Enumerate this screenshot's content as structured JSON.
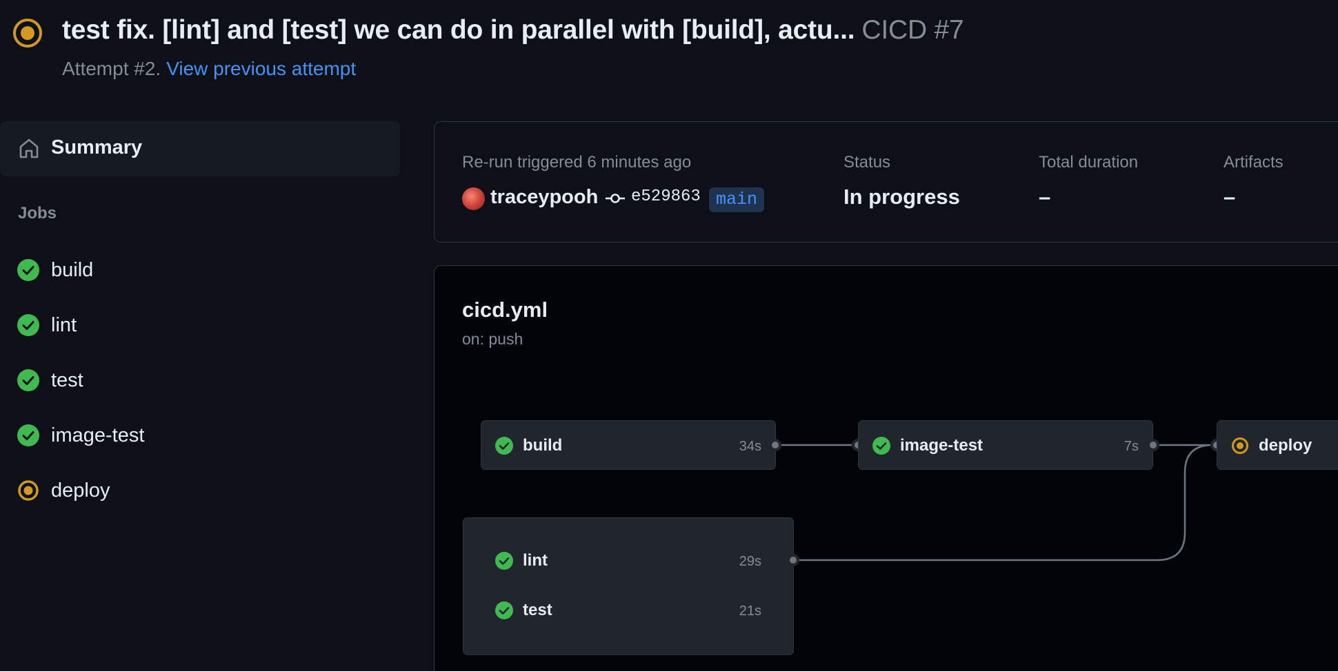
{
  "header": {
    "title": "test fix. [lint] and [test] we can do in parallel with [build], actu...",
    "workflow_run": "CICD #7",
    "attempt_text": "Attempt #2.",
    "previous_attempt_link": "View previous attempt",
    "status_icon": "in-progress-icon"
  },
  "sidebar": {
    "summary_label": "Summary",
    "summary_icon": "home-icon",
    "jobs_heading": "Jobs",
    "jobs": [
      {
        "name": "build",
        "status": "success"
      },
      {
        "name": "lint",
        "status": "success"
      },
      {
        "name": "test",
        "status": "success"
      },
      {
        "name": "image-test",
        "status": "success"
      },
      {
        "name": "deploy",
        "status": "in_progress"
      }
    ]
  },
  "summary_card": {
    "trigger_text": "Re-run triggered 6 minutes ago",
    "actor": "traceypooh",
    "commit_sha": "e529863",
    "branch": "main",
    "status_label": "Status",
    "status_value": "In progress",
    "duration_label": "Total duration",
    "duration_value": "–",
    "artifacts_label": "Artifacts",
    "artifacts_value": "–"
  },
  "graph": {
    "file": "cicd.yml",
    "trigger": "on: push",
    "nodes": {
      "build": {
        "name": "build",
        "duration": "34s",
        "status": "success"
      },
      "image_test": {
        "name": "image-test",
        "duration": "7s",
        "status": "success"
      },
      "deploy": {
        "name": "deploy",
        "duration": "",
        "status": "in_progress"
      },
      "lint": {
        "name": "lint",
        "duration": "29s",
        "status": "success"
      },
      "test": {
        "name": "test",
        "duration": "21s",
        "status": "success"
      }
    }
  },
  "colors": {
    "success": "#3fb950",
    "in_progress": "#d29922",
    "link": "#4493f8",
    "background": "#0d1117"
  }
}
